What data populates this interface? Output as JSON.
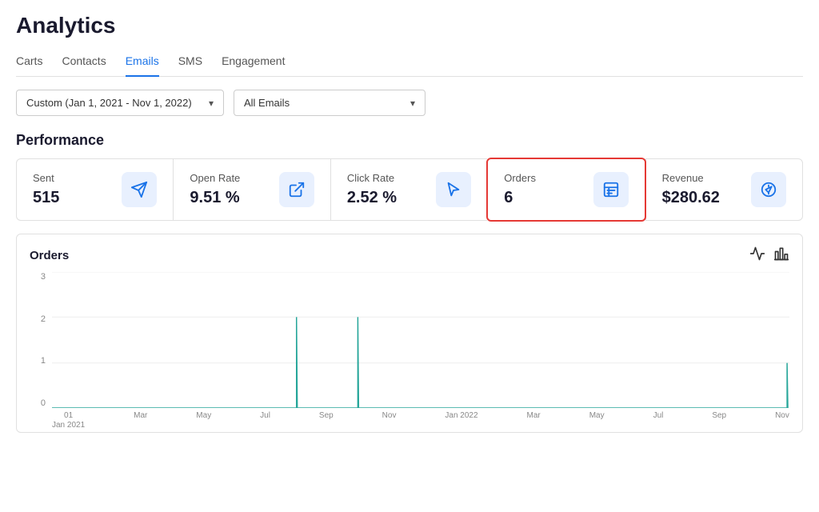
{
  "page": {
    "title": "Analytics"
  },
  "tabs": [
    {
      "label": "Carts",
      "active": false
    },
    {
      "label": "Contacts",
      "active": false
    },
    {
      "label": "Emails",
      "active": true
    },
    {
      "label": "SMS",
      "active": false
    },
    {
      "label": "Engagement",
      "active": false
    }
  ],
  "filters": {
    "date_range": "Custom (Jan 1, 2021 - Nov 1, 2022)",
    "email_filter": "All Emails"
  },
  "performance": {
    "section_title": "Performance",
    "metrics": [
      {
        "label": "Sent",
        "value": "515",
        "icon": "send"
      },
      {
        "label": "Open Rate",
        "value": "9.51 %",
        "icon": "open"
      },
      {
        "label": "Click Rate",
        "value": "2.52 %",
        "icon": "click"
      },
      {
        "label": "Orders",
        "value": "6",
        "icon": "orders",
        "highlighted": true
      },
      {
        "label": "Revenue",
        "value": "$280.62",
        "icon": "revenue"
      }
    ]
  },
  "chart": {
    "title": "Orders",
    "y_labels": [
      "3",
      "2",
      "1",
      "0"
    ],
    "x_labels": [
      {
        "line1": "01",
        "line2": "Jan 2021"
      },
      {
        "line1": "",
        "line2": "Mar"
      },
      {
        "line1": "",
        "line2": "May"
      },
      {
        "line1": "",
        "line2": "Jul"
      },
      {
        "line1": "",
        "line2": "Sep"
      },
      {
        "line1": "",
        "line2": "Nov"
      },
      {
        "line1": "",
        "line2": "Jan 2022"
      },
      {
        "line1": "",
        "line2": "Mar"
      },
      {
        "line1": "",
        "line2": "May"
      },
      {
        "line1": "",
        "line2": "Jul"
      },
      {
        "line1": "",
        "line2": "Sep"
      },
      {
        "line1": "",
        "line2": "Nov"
      }
    ]
  }
}
